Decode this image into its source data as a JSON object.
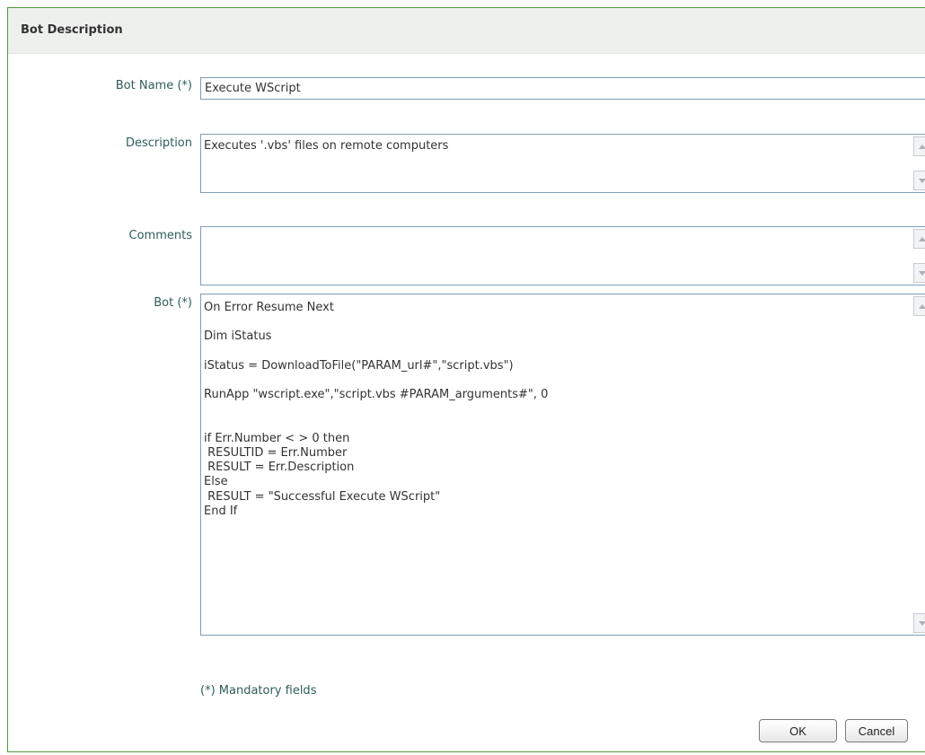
{
  "header": {
    "title": "Bot Description"
  },
  "form": {
    "bot_name": {
      "label": "Bot Name (*)",
      "value": "Execute WScript"
    },
    "description": {
      "label": "Description",
      "value": "Executes '.vbs' files on remote computers"
    },
    "comments": {
      "label": "Comments",
      "value": ""
    },
    "bot": {
      "label": "Bot (*)",
      "value": "On Error Resume Next\n\nDim iStatus\n\niStatus = DownloadToFile(\"PARAM_url#\",\"script.vbs\")\n\nRunApp \"wscript.exe\",\"script.vbs #PARAM_arguments#\", 0\n\n\nif Err.Number < > 0 then\n RESULTID = Err.Number\n RESULT = Err.Description\nElse\n RESULT = \"Successful Execute WScript\"\nEnd If"
    }
  },
  "footer": {
    "mandatory_note": "(*) Mandatory fields",
    "ok_label": "OK",
    "cancel_label": "Cancel"
  },
  "icons": {
    "scroll_up": "chevron-up-icon",
    "scroll_down": "chevron-down-icon"
  },
  "colors": {
    "frame_border": "#4e9a3a",
    "label_text": "#2e5e58",
    "field_border": "#7f9db9",
    "header_bg": "#eef0ee"
  }
}
